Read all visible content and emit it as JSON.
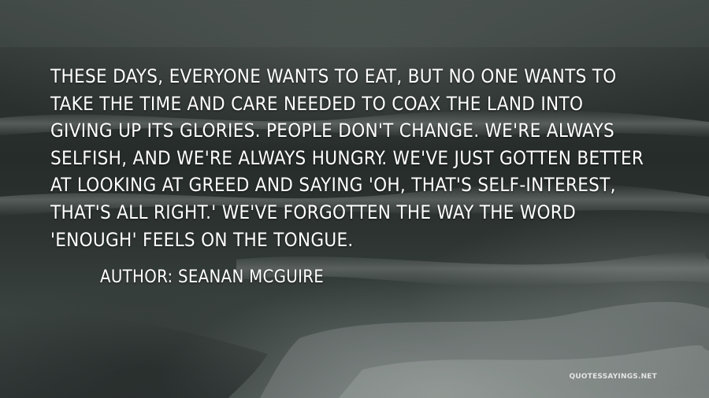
{
  "quote": {
    "text": "These days, everyone wants to eat, but no one wants to take the time and care needed to coax the land into giving up its glories. People don't change. We're always selfish, and we're always hungry. We've just gotten better at looking at greed and saying 'oh, that's self-interest, that's all right.' We've forgotten the way the word 'enough' feels on the tongue."
  },
  "attribution": {
    "text": "Author: Seanan McGuire"
  },
  "watermark": {
    "text": "quotessayings.net"
  },
  "colors": {
    "text": "#ffffff",
    "background": "#2a302e"
  }
}
